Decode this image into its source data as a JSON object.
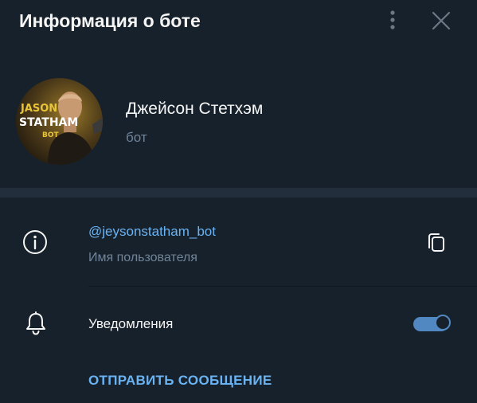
{
  "header": {
    "title": "Информация о боте",
    "more_icon": "more-vertical-icon",
    "close_icon": "close-icon"
  },
  "profile": {
    "name": "Джейсон Стетхэм",
    "status": "бот",
    "avatar_text": [
      "JASON",
      "STATHAM",
      "BOT"
    ]
  },
  "info": {
    "username": "@jeysonstatham_bot",
    "username_caption": "Имя пользователя",
    "info_icon": "info-icon",
    "copy_icon": "copy-icon"
  },
  "notifications": {
    "label": "Уведомления",
    "bell_icon": "bell-icon",
    "enabled": true
  },
  "actions": {
    "send_message": "ОТПРАВИТЬ СООБЩЕНИЕ"
  },
  "colors": {
    "background": "#17212b",
    "divider_band": "#232e3c",
    "accent_link": "#6ab3f3",
    "toggle_on": "#5288c1",
    "secondary_text": "#708499",
    "primary_text": "#f5f5f5"
  }
}
